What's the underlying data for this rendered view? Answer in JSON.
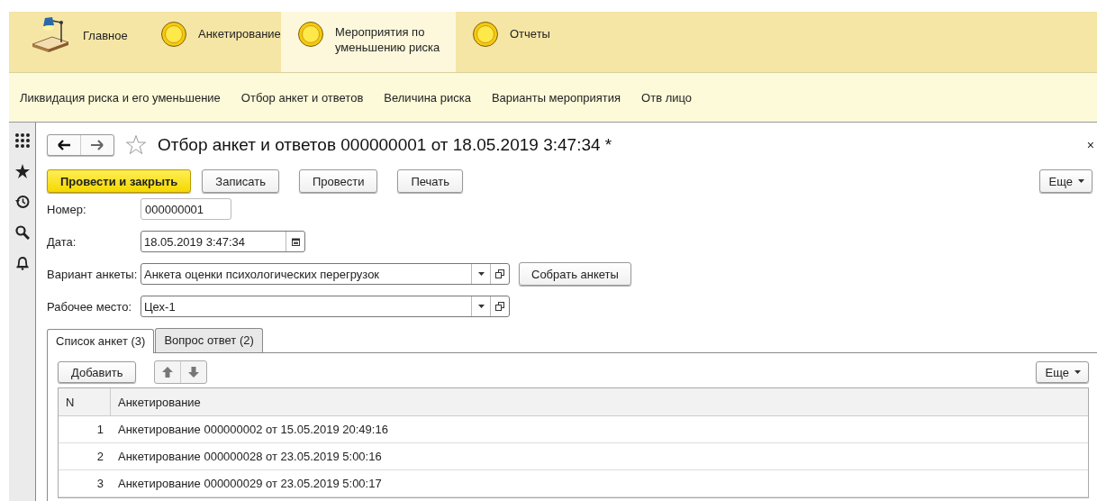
{
  "sections": [
    {
      "label": "Главное",
      "kind": "lamp",
      "selected": false
    },
    {
      "label": "Анкетирование",
      "kind": "circle",
      "selected": false
    },
    {
      "label": "Мероприятия по уменьшению риска",
      "kind": "circle",
      "selected": true
    },
    {
      "label": "Отчеты",
      "kind": "circle",
      "selected": false
    }
  ],
  "nav": [
    "Ликвидация риска и его уменьшение",
    "Отбор анкет и ответов",
    "Величина риска",
    "Варианты мероприятия",
    "Отв лицо"
  ],
  "form": {
    "title": "Отбор анкет и ответов 000000001 от 18.05.2019 3:47:34 *",
    "close": "×",
    "buttons": [
      {
        "label": "Провести и закрыть",
        "kind": "default"
      },
      {
        "label": "Записать",
        "kind": "plain"
      },
      {
        "label": "Провести",
        "kind": "plain"
      },
      {
        "label": "Печать",
        "kind": "plain"
      }
    ],
    "more": "Еще",
    "fields": [
      {
        "label": "Номер:",
        "value": "000000001",
        "kind": "text"
      },
      {
        "label": "Дата:",
        "value": "18.05.2019  3:47:34",
        "kind": "date"
      },
      {
        "label": "Вариант анкеты:",
        "value": "Анкета оценки психологических перегрузок",
        "kind": "select",
        "action": "Собрать анкеты"
      },
      {
        "label": "Рабочее место:",
        "value": "Цех-1",
        "kind": "select"
      }
    ],
    "tabs": [
      {
        "label": "Список анкет (3)",
        "selected": true
      },
      {
        "label": "Вопрос ответ (2)",
        "selected": false
      }
    ],
    "table": {
      "add": "Добавить",
      "more": "Еще",
      "columns": [
        "N",
        "Анкетирование"
      ],
      "rows": [
        [
          "1",
          "Анкетирование 000000002 от 15.05.2019 20:49:16"
        ],
        [
          "2",
          "Анкетирование 000000028 от 23.05.2019 5:00:16"
        ],
        [
          "3",
          "Анкетирование 000000029 от 23.05.2019 5:00:17"
        ]
      ]
    }
  }
}
